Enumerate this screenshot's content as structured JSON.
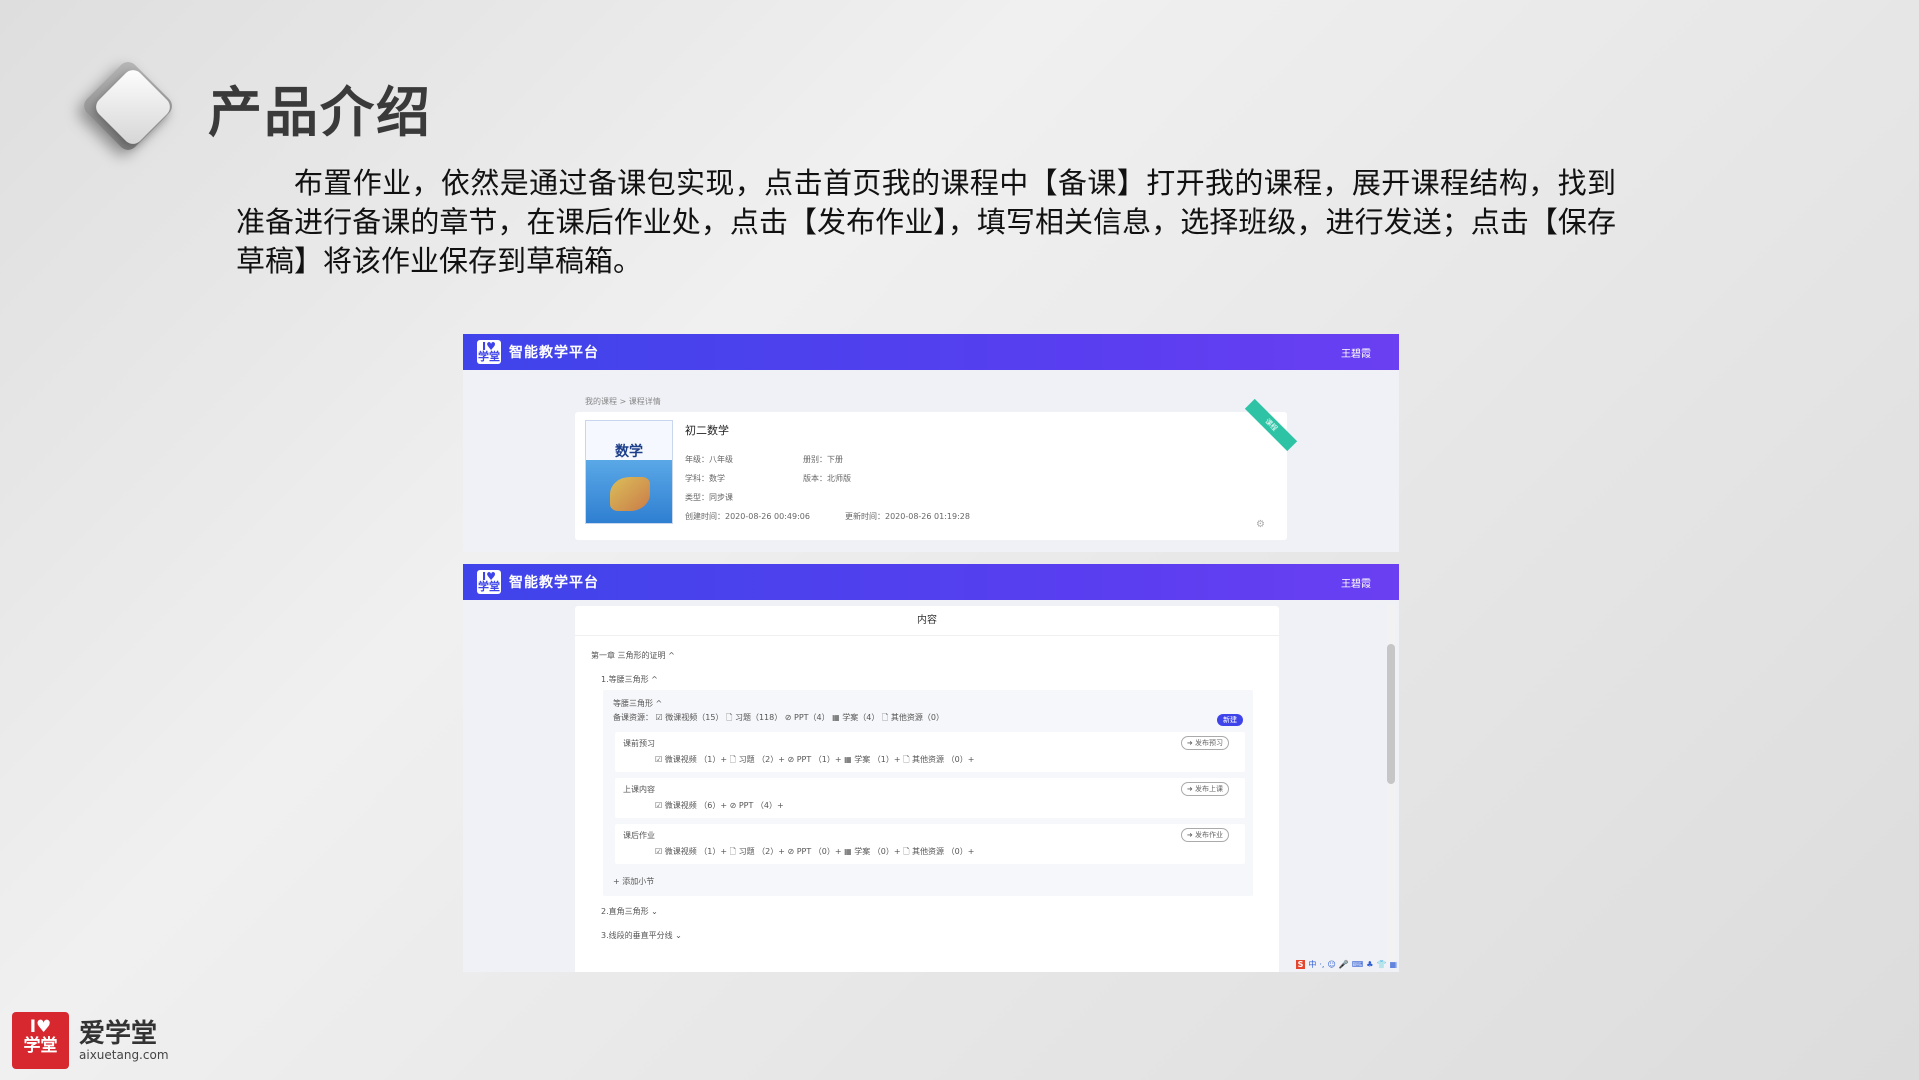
{
  "slide": {
    "title": "产品介绍",
    "intro": "布置作业，依然是通过备课包实现，点击首页我的课程中【备课】打开我的课程，展开课程结构，找到准备进行备课的章节，在课后作业处，点击【发布作业】，填写相关信息，选择班级，进行发送；点击【保存草稿】将该作业保存到草稿箱。"
  },
  "top_screen": {
    "nav": {
      "logo": "I♥学堂",
      "title": "智能教学平台",
      "user": "王碧霞"
    },
    "breadcrumb": "我的课程 > 课程详情",
    "course": {
      "book_word": "数学",
      "title": "初二数学",
      "grade": "年级：八年级",
      "volume": "册别：下册",
      "subject": "学科：数学",
      "edition": "版本：北师版",
      "type": "类型：同步课",
      "created": "创建时间：2020-08-26 00:49:06",
      "updated": "更新时间：2020-08-26 01:19:28",
      "ribbon": "课程"
    }
  },
  "bottom_screen": {
    "nav": {
      "logo": "I♥学堂",
      "title": "智能教学平台",
      "user": "王碧霞"
    },
    "content_header": "内容",
    "chapter": "第一章 三角形的证明  ^",
    "section1": "1.等腰三角形  ^",
    "subsection": "等腰三角形  ^",
    "resources": "备课资源：  ☑ 微课视频（15）    🗋 习题（118）    ⊘ PPT（4）    ▦ 学案（4）    🗋 其他资源（0）",
    "new_tag": "新建",
    "preclass": {
      "label": "课前预习",
      "items": "☑ 微课视频  （1）+      🗋 习题  （2）+      ⊘ PPT  （1）+      ▦ 学案  （1）+      🗋 其他资源  （0）+",
      "button": "➜ 发布预习"
    },
    "inclass": {
      "label": "上课内容",
      "items": "☑ 微课视频  （6）+      ⊘ PPT  （4）+",
      "button": "➜ 发布上课"
    },
    "homework": {
      "label": "课后作业",
      "items": "☑ 微课视频  （1）+      🗋 习题  （2）+      ⊘ PPT  （0）+      ▦ 学案  （0）+      🗋 其他资源  （0）+",
      "button": "➜ 发布作业"
    },
    "add_subsection": "+ 添加小节",
    "section2": "2.直角三角形  ⌄",
    "section3": "3.线段的垂直平分线  ⌄",
    "tray": [
      "S",
      "中",
      "·,",
      "☺",
      "🎤",
      "⌨",
      "♣",
      "👕",
      "▦"
    ]
  },
  "brand": {
    "icon_text": "I♥\n学堂",
    "name": "爱学堂",
    "url": "aixuetang.com"
  },
  "colors": {
    "nav": "#3f44ea",
    "brand_red": "#d8282f",
    "ribbon": "#2fc3a6"
  }
}
